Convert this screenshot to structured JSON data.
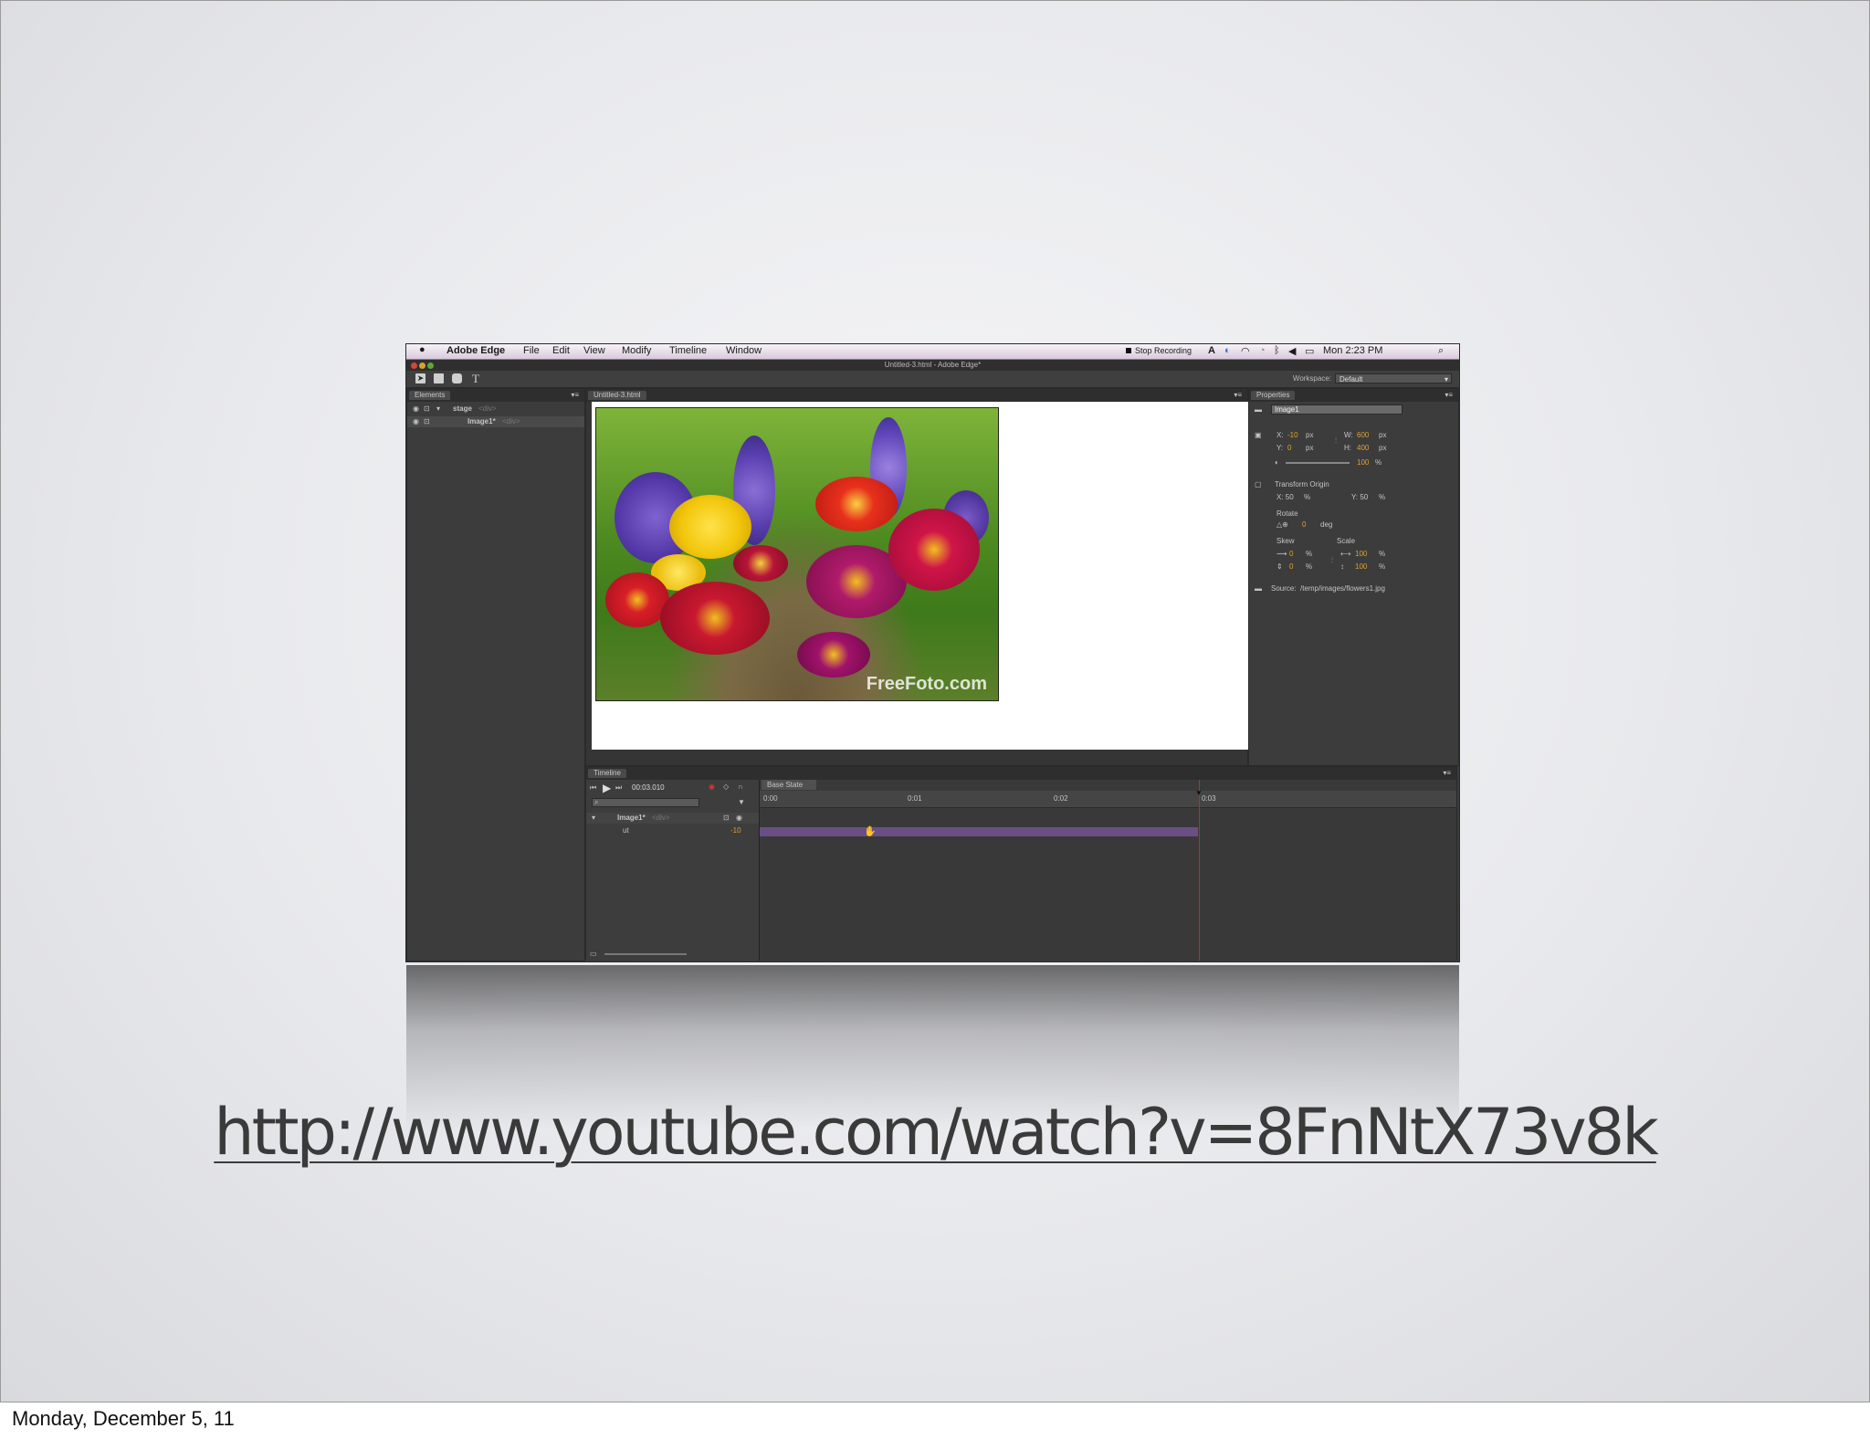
{
  "slide": {
    "url": "http://www.youtube.com/watch?v=8FnNtX73v8k",
    "footer_date": "Monday, December 5, 11"
  },
  "app": {
    "menu": {
      "apple": "",
      "app_name": "Adobe Edge",
      "items": [
        "File",
        "Edit",
        "View",
        "Modify",
        "Timeline",
        "Window"
      ],
      "status_recording": "Stop Recording",
      "clock": "Mon 2:23 PM"
    },
    "window_title": "Untitled-3.html - Adobe Edge*",
    "toolbar": {
      "text_tool": "T",
      "workspace_label": "Workspace:",
      "workspace_value": "Default"
    },
    "elements_panel": {
      "tab": "Elements",
      "rows": [
        {
          "name": "stage",
          "tag": "<div>"
        },
        {
          "name": "Image1*",
          "tag": "<div>"
        }
      ]
    },
    "stage_panel": {
      "tab": "Untitled-3.html",
      "watermark": "FreeFoto.com"
    },
    "properties_panel": {
      "tab": "Properties",
      "id_value": "Image1",
      "x_label": "X:",
      "x_value": "-10",
      "x_unit": "px",
      "y_label": "Y:",
      "y_value": "0",
      "y_unit": "px",
      "w_label": "W:",
      "w_value": "600",
      "w_unit": "px",
      "h_label": "H:",
      "h_value": "400",
      "h_unit": "px",
      "opacity_value": "100",
      "opacity_unit": "%",
      "transform_origin": "Transform Origin",
      "origin_x": "X: 50",
      "origin_x_unit": "%",
      "origin_y": "Y: 50",
      "origin_y_unit": "%",
      "rotate_label": "Rotate",
      "rotate_value": "0",
      "rotate_unit": "deg",
      "skew_label": "Skew",
      "skew_x": "0",
      "skew_y": "0",
      "skew_unit": "%",
      "scale_label": "Scale",
      "scale_x": "100",
      "scale_y": "100",
      "scale_unit": "%",
      "source_label": "Source:",
      "source_value": "/temp/images/flowers1.jpg"
    },
    "timeline": {
      "tab": "Timeline",
      "time": "00:03.010",
      "base_state": "Base State",
      "ruler": [
        "0:00",
        "0:01",
        "0:02",
        "0:03"
      ],
      "rows": [
        {
          "name": "Image1*",
          "tag": "<div>"
        },
        {
          "name": "ut",
          "value": "-10"
        }
      ]
    }
  }
}
